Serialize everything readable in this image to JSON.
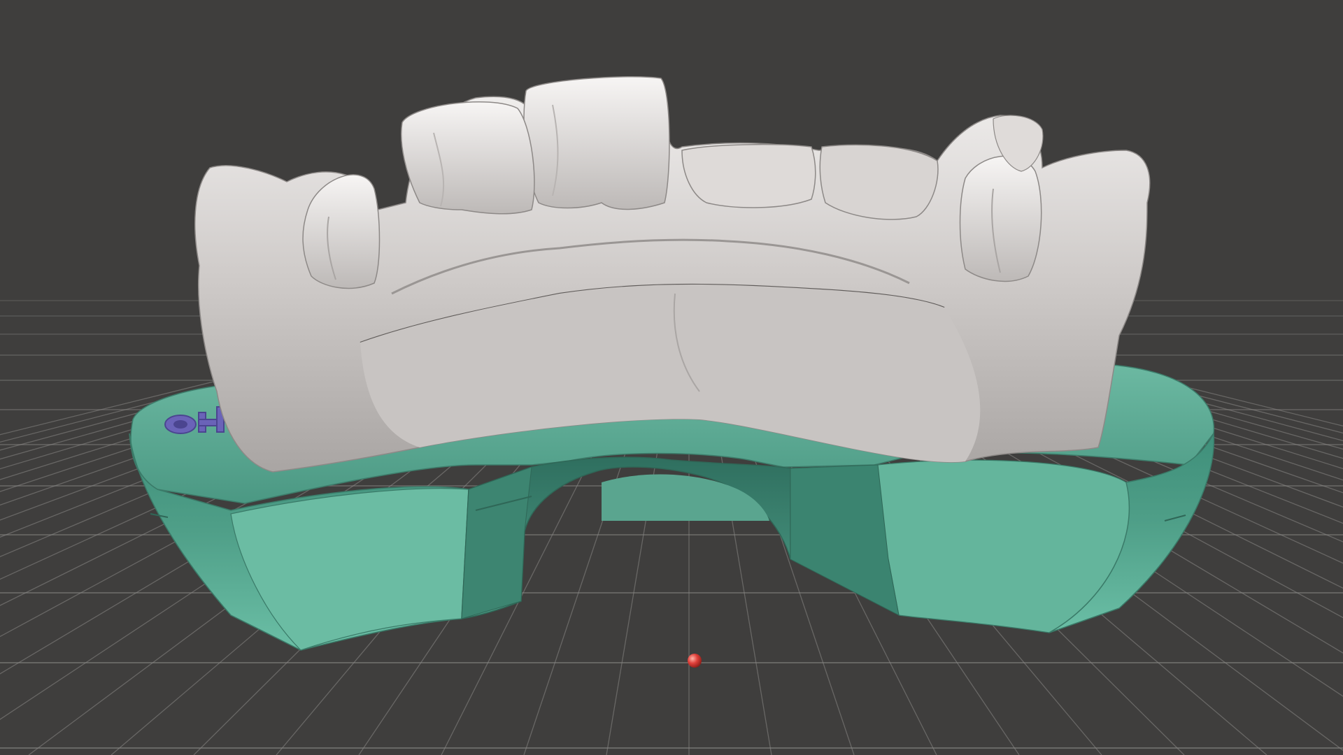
{
  "viewport": {
    "background_color": "#3f3e3d",
    "grid_color": "#8a8986"
  },
  "model": {
    "arch_color": "#d9d6d4",
    "base_color": "#5fae98",
    "label_color": "#6a63b8",
    "label_text": "o4"
  },
  "origin_marker": {
    "color": "#e0403a"
  }
}
